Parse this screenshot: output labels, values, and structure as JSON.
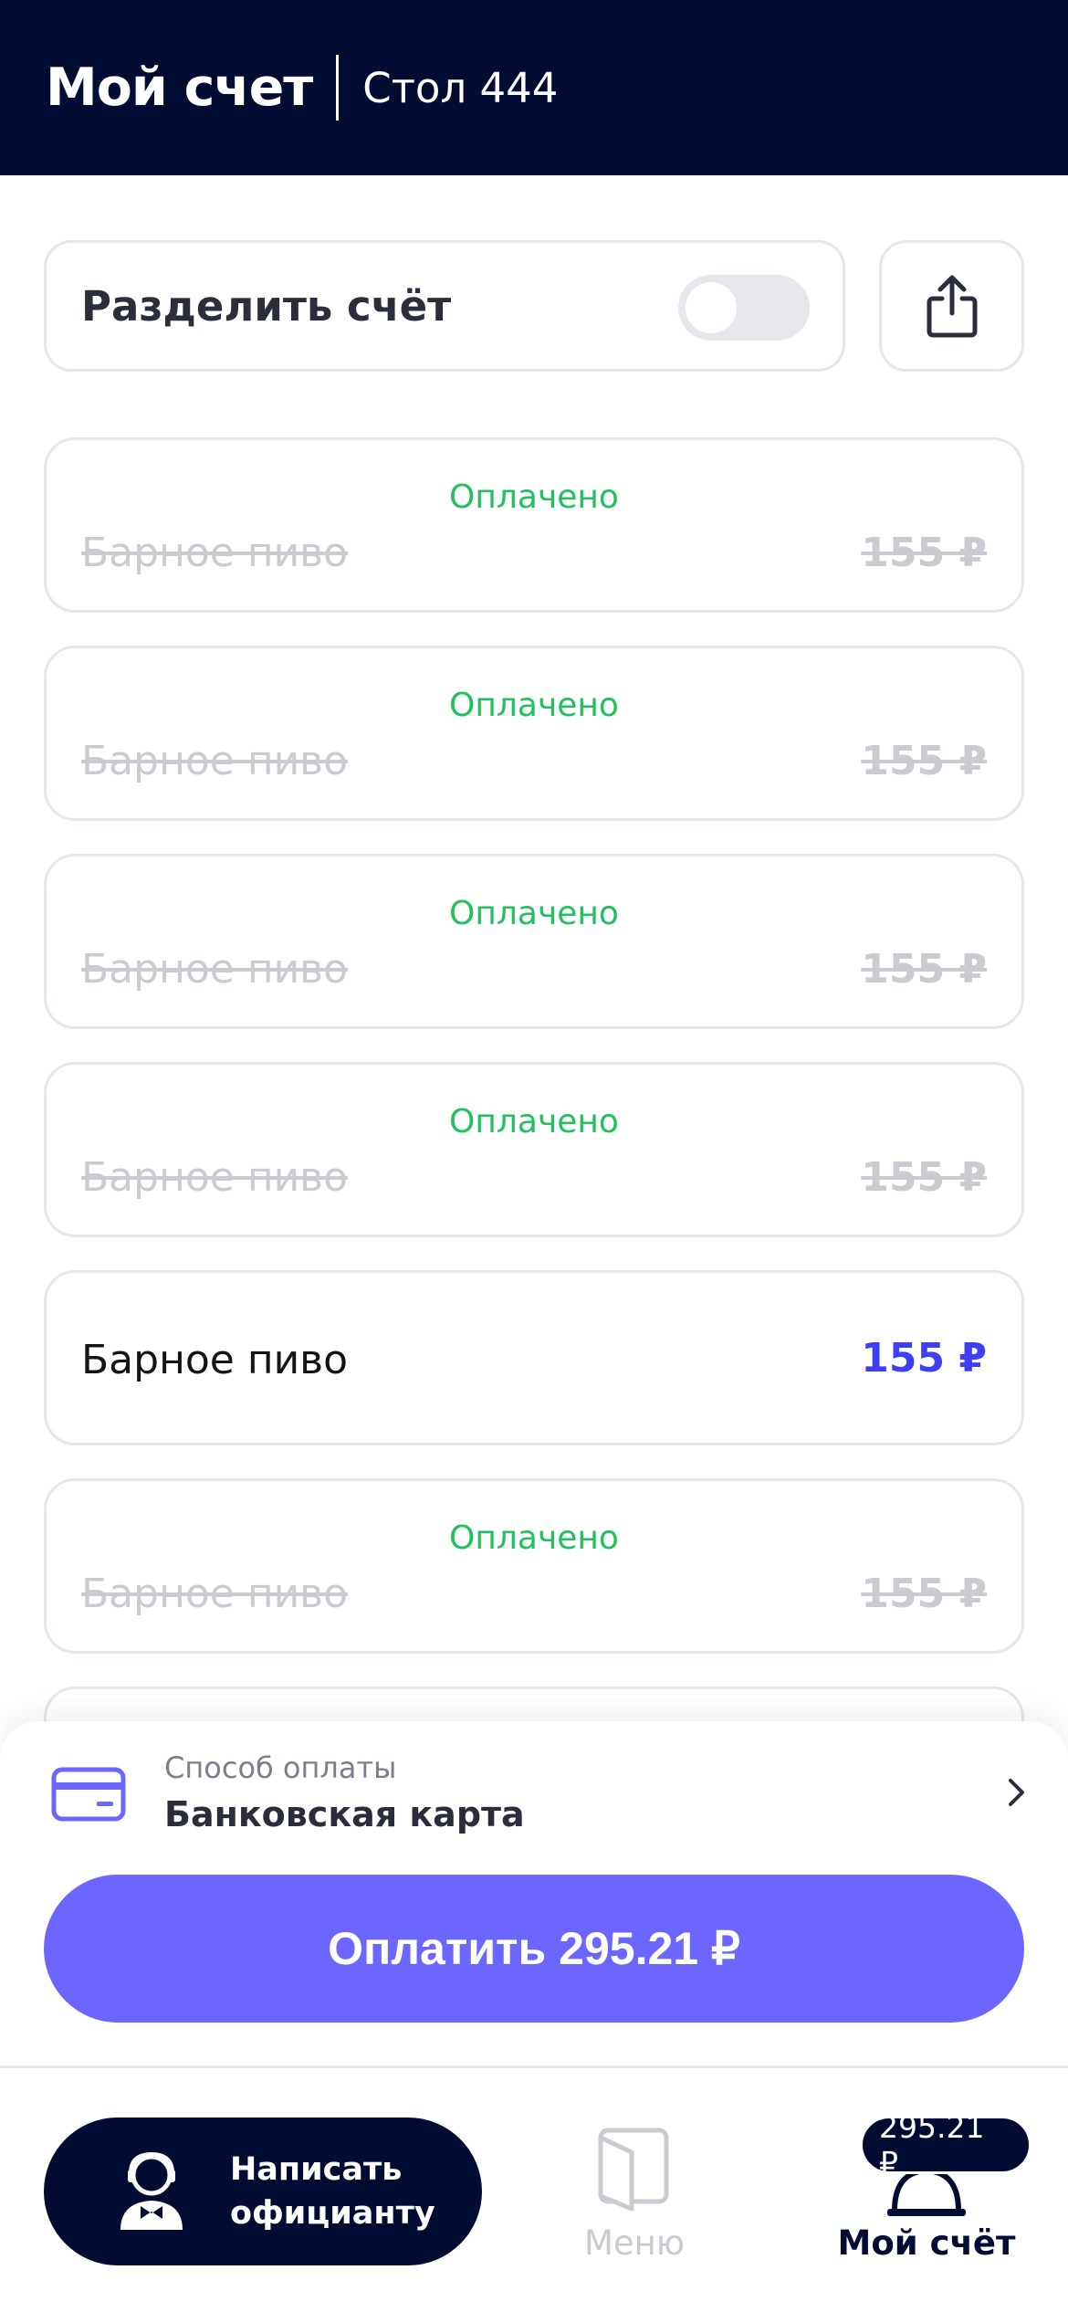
{
  "header": {
    "title": "Мой счет",
    "table": "Стол 444"
  },
  "split": {
    "label": "Разделить счёт",
    "enabled": false
  },
  "icons": {
    "share": "share-icon",
    "card": "card-icon",
    "chevron": "chevron-right-icon",
    "waiter": "waiter-icon",
    "menu": "menu-book-icon",
    "bill": "cloche-icon"
  },
  "colors": {
    "header_bg": "#020c33",
    "paid_green": "#22c05f",
    "accent": "#6b66ff",
    "price_blue": "#3e3ef2"
  },
  "items": [
    {
      "status": "Оплачено",
      "name": "Барное пиво",
      "price": "155 ₽",
      "paid": true
    },
    {
      "status": "Оплачено",
      "name": "Барное пиво",
      "price": "155 ₽",
      "paid": true
    },
    {
      "status": "Оплачено",
      "name": "Барное пиво",
      "price": "155 ₽",
      "paid": true
    },
    {
      "status": "Оплачено",
      "name": "Барное пиво",
      "price": "155 ₽",
      "paid": true
    },
    {
      "status": "",
      "name": "Барное пиво",
      "price": "155 ₽",
      "paid": false
    },
    {
      "status": "Оплачено",
      "name": "Барное пиво",
      "price": "155 ₽",
      "paid": true
    }
  ],
  "payment": {
    "caption": "Способ оплаты",
    "method": "Банковская карта",
    "button": "Оплатить 295.21 ₽"
  },
  "nav": {
    "waiter_line1": "Написать",
    "waiter_line2": "официанту",
    "menu": "Меню",
    "bill": "Мой счёт",
    "bill_badge": "295.21 ₽"
  }
}
